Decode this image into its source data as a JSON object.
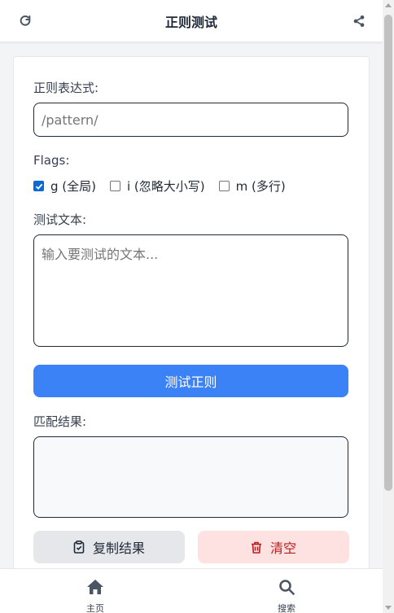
{
  "header": {
    "title": "正则测试",
    "refresh_icon": "refresh-icon",
    "share_icon": "share-icon"
  },
  "form": {
    "pattern_label": "正则表达式:",
    "pattern_placeholder": "/pattern/",
    "flags_label": "Flags:",
    "flags": [
      {
        "label": "g (全局)",
        "checked": true
      },
      {
        "label": "i (忽略大小写)",
        "checked": false
      },
      {
        "label": "m (多行)",
        "checked": false
      }
    ],
    "text_label": "测试文本:",
    "text_placeholder": "输入要测试的文本...",
    "test_button": "测试正则",
    "result_label": "匹配结果:",
    "result_value": "",
    "copy_button": "复制结果",
    "clear_button": "清空"
  },
  "bottom_nav": {
    "items": [
      {
        "label": "主页",
        "icon": "home-icon"
      },
      {
        "label": "搜索",
        "icon": "search-icon"
      }
    ]
  },
  "colors": {
    "primary": "#3b82f6",
    "danger_bg": "#fee2e2",
    "danger_text": "#b91c1c",
    "secondary_bg": "#e5e7eb"
  }
}
